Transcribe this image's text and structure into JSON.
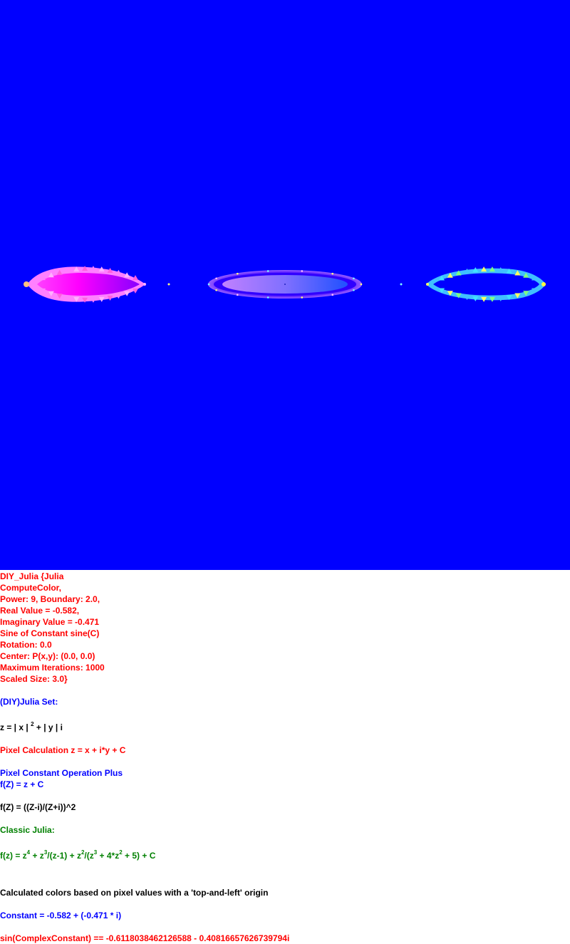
{
  "canvas": {
    "background": "#0000ff",
    "palette": {
      "left_lobe": "#ff00ff",
      "center_lobe_start": "#b070ff",
      "center_lobe_end": "#3060ff",
      "right_lobe_edge": "#20ffff"
    }
  },
  "params": {
    "line1": "DIY_Julia {Julia",
    "line2": "ComputeColor,",
    "line3": "Power: 9, Boundary: 2.0,",
    "line4": "Real Value = -0.582,",
    "line5": "Imaginary Value = -0.471",
    "line6": "Sine of Constant sine(C)",
    "line7": "Rotation: 0.0",
    "line8": "Center: P(x,y): (0.0, 0.0)",
    "line9": "Maximum Iterations: 1000",
    "line10": "Scaled Size: 3.0}"
  },
  "julia_set_title": "(DIY)Julia Set:",
  "z_formula": {
    "part1": "z = | x | ",
    "exp": "2",
    "part2": " + | y | i"
  },
  "pixel_calculation": "Pixel Calculation z = x + i*y + C",
  "pixel_constant": {
    "line1": "Pixel Constant Operation Plus",
    "line2": "f(Z) = z + C"
  },
  "f_formula": "f(Z) = ((Z-i)/(Z+i))^2",
  "classic_julia_title": "Classic Julia:",
  "classic_formula": {
    "p1": "f(z) = z",
    "e1": "4",
    "p2": " + z",
    "e2": "3",
    "p3": "/(z-1) + z",
    "e3": "2",
    "p4": "/(z",
    "e4": "3",
    "p5": " + 4*z",
    "e5": "2",
    "p6": " + 5) + C"
  },
  "calculated_colors": "Calculated colors based on pixel values with a 'top-and-left' origin",
  "constant_line": "Constant = -0.582 + (-0.471 * i)",
  "sin_line": "sin(ComplexConstant) == -0.6118038462126588 - 0.40816657626739794i"
}
